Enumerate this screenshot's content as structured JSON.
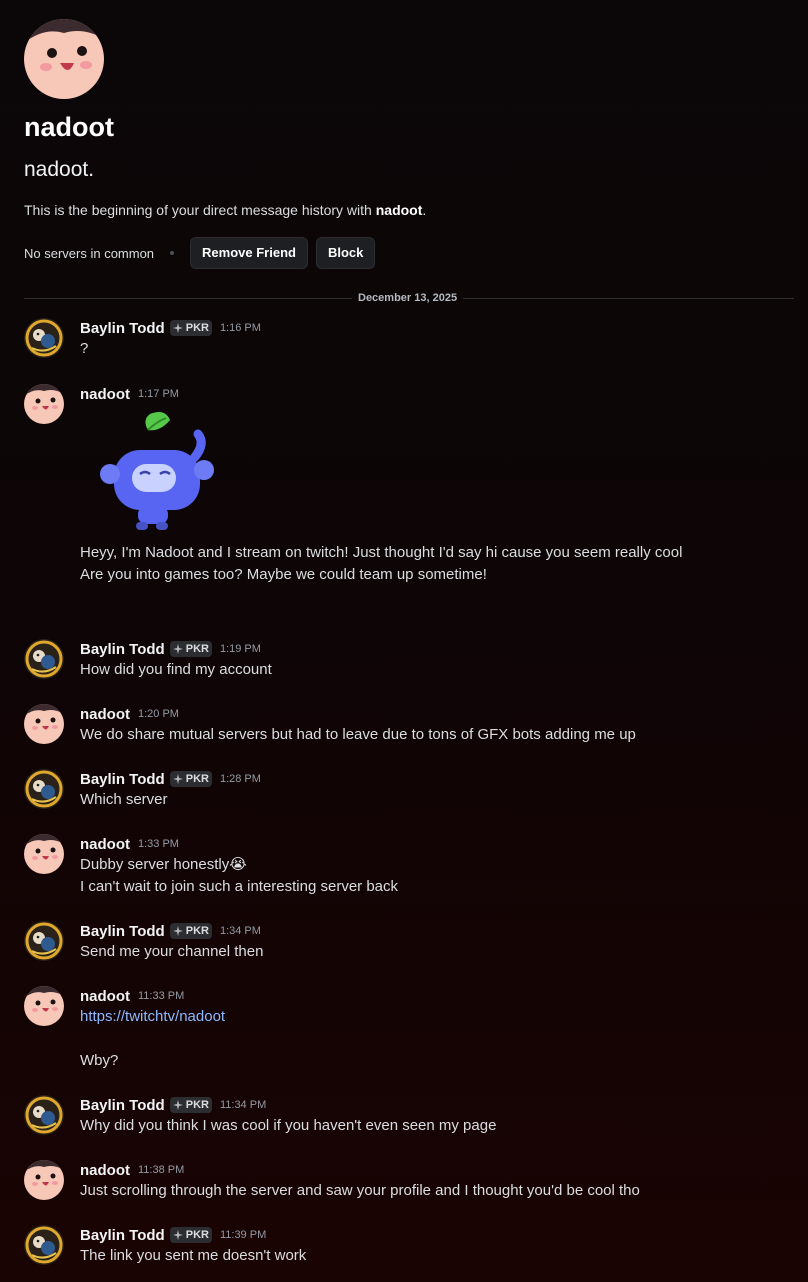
{
  "profile": {
    "display_name": "nadoot",
    "username": "nadoot.",
    "intro_prefix": "This is the beginning of your direct message history with ",
    "intro_name": "nadoot",
    "intro_suffix": ".",
    "servers_text": "No servers in common",
    "remove_friend_label": "Remove Friend",
    "block_label": "Block"
  },
  "date_divider": "December 13, 2025",
  "colors": {
    "link": "#8cb8ff",
    "tag_bg": "#2b2d31",
    "background": "#0b0708"
  },
  "messages": [
    {
      "author": "Baylin Todd",
      "tag": "PKR",
      "time": "1:16 PM",
      "lines": [
        "?"
      ]
    },
    {
      "author": "nadoot",
      "time": "1:17 PM",
      "sticker": "discord-mascot-sticker",
      "lines": [
        "Heyy, I'm Nadoot and I stream on twitch! Just thought I'd say hi cause you seem really cool",
        "Are you into games too? Maybe we could team up sometime!"
      ]
    },
    {
      "author": "Baylin Todd",
      "tag": "PKR",
      "time": "1:19 PM",
      "lines": [
        "How did you find my account"
      ]
    },
    {
      "author": "nadoot",
      "time": "1:20 PM",
      "lines": [
        "We do share mutual servers but had to leave due to tons of GFX bots adding me up"
      ]
    },
    {
      "author": "Baylin Todd",
      "tag": "PKR",
      "time": "1:28 PM",
      "lines": [
        "Which server"
      ]
    },
    {
      "author": "nadoot",
      "time": "1:33 PM",
      "emoji": "😭",
      "lines": [
        "Dubby server honestly",
        "I can't wait to join such a interesting server back"
      ]
    },
    {
      "author": "Baylin Todd",
      "tag": "PKR",
      "time": "1:34 PM",
      "lines": [
        "Send me your channel then"
      ]
    },
    {
      "author": "nadoot",
      "time": "11:33 PM",
      "link": "https://twitchtv/nadoot",
      "lines": [
        "Wby?"
      ]
    },
    {
      "author": "Baylin Todd",
      "tag": "PKR",
      "time": "11:34 PM",
      "lines": [
        "Why did you think I was cool if you haven't even seen my page"
      ]
    },
    {
      "author": "nadoot",
      "time": "11:38 PM",
      "lines": [
        "Just scrolling through the server and saw your profile and I thought you'd be cool tho"
      ]
    },
    {
      "author": "Baylin Todd",
      "tag": "PKR",
      "time": "11:39 PM",
      "lines": [
        "The link you sent me doesn't work"
      ]
    }
  ]
}
